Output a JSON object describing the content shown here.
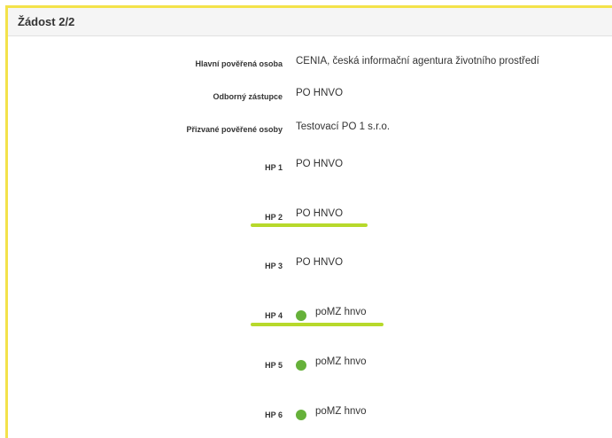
{
  "panel": {
    "title": "Žádost 2/2"
  },
  "rows": [
    {
      "label": "Hlavní pověřená osoba",
      "value": "CENIA, česká informační agentura životního prostředí"
    },
    {
      "label": "Odborný zástupce",
      "value": "PO HNVO"
    },
    {
      "label": "Přizvané pověřené osoby",
      "value": "Testovací PO 1 s.r.o."
    },
    {
      "label": "HP 1",
      "value": "PO HNVO"
    },
    {
      "label": "HP 2",
      "value": "PO HNVO"
    },
    {
      "label": "HP 3",
      "value": "PO HNVO"
    },
    {
      "label": "HP 4",
      "value": "poMZ hnvo",
      "status": "green-dot"
    },
    {
      "label": "HP 5",
      "value": "poMZ hnvo",
      "status": "green-dot"
    },
    {
      "label": "HP 6",
      "value": "poMZ hnvo",
      "status": "green-dot"
    }
  ],
  "colors": {
    "panel_border": "#f3e24a",
    "status_dot": "#66b13a",
    "highlight_underline": "#b7d92b"
  }
}
